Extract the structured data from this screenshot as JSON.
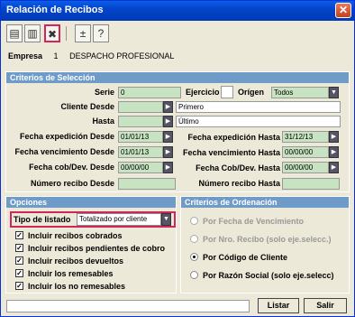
{
  "window": {
    "title": "Relación de Recibos",
    "close": "✕"
  },
  "toolbar": {
    "buttons": [
      {
        "name": "print-icon",
        "glyph": "▤"
      },
      {
        "name": "preview-icon",
        "glyph": "▥"
      },
      {
        "name": "tools-icon",
        "glyph": "✖"
      },
      {
        "name": "add-icon",
        "glyph": "±"
      },
      {
        "name": "help-icon",
        "glyph": "?"
      }
    ]
  },
  "empresa": {
    "label": "Empresa",
    "code": "1",
    "name": "DESPACHO PROFESIONAL"
  },
  "criterios": {
    "title": "Criterios de Selección",
    "serie": {
      "label": "Serie",
      "value": "0"
    },
    "ejercicio": {
      "label": "Ejercicio",
      "value": ""
    },
    "origen": {
      "label": "Orígen",
      "value": "Todos"
    },
    "cliente_desde": {
      "label": "Cliente Desde",
      "value": "Primero"
    },
    "hasta": {
      "label": "Hasta",
      "value": "Último"
    },
    "fecha_exp_desde": {
      "label": "Fecha expedición Desde",
      "value": "01/01/13"
    },
    "fecha_exp_hasta": {
      "label": "Fecha expedición Hasta",
      "value": "31/12/13"
    },
    "fecha_venc_desde": {
      "label": "Fecha vencimiento Desde",
      "value": "01/01/13"
    },
    "fecha_venc_hasta": {
      "label": "Fecha vencimiento Hasta",
      "value": "00/00/00"
    },
    "fecha_cob_desde": {
      "label": "Fecha cob/Dev. Desde",
      "value": "00/00/00"
    },
    "fecha_cob_hasta": {
      "label": "Fecha Cob/Dev. Hasta",
      "value": "00/00/00"
    },
    "num_desde": {
      "label": "Número recibo Desde",
      "value": ""
    },
    "num_hasta": {
      "label": "Número recibo Hasta",
      "value": ""
    }
  },
  "opciones": {
    "title": "Opciones",
    "tipo_label": "Tipo de listado",
    "tipo_value": "Totalizado por cliente",
    "checks": [
      {
        "label": "Incluir recibos cobrados",
        "checked": "✓"
      },
      {
        "label": "Incluir recibos pendientes de cobro",
        "checked": "✓"
      },
      {
        "label": "Incluir recibos devueltos",
        "checked": "✓"
      },
      {
        "label": "Incluir los remesables",
        "checked": "✓"
      },
      {
        "label": "Incluir los no remesables",
        "checked": "✓"
      }
    ]
  },
  "ordenacion": {
    "title": "Criterios de Ordenación",
    "options": [
      {
        "label": "Por Fecha de Vencimiento",
        "state": "disabled"
      },
      {
        "label": "Por Nro. Recibo (solo eje.selecc.)",
        "state": "disabled"
      },
      {
        "label": "Por Código de Cliente",
        "state": "selected"
      },
      {
        "label": "Por Razón Social (solo eje.selecc)",
        "state": "enabled"
      }
    ]
  },
  "buttons": {
    "listar": "Listar",
    "salir": "Salir"
  },
  "arrow_glyph": "▶",
  "dropdown_glyph": "▼"
}
